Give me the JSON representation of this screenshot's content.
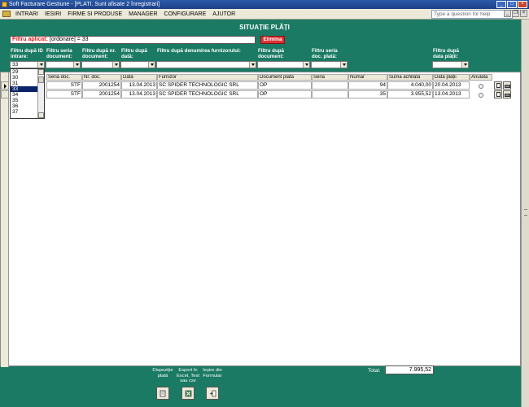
{
  "window": {
    "title": "Soft Facturare Gestiune - [PLATI. Sunt afisate 2 înregistrari]"
  },
  "menu": {
    "items": [
      "INTRARI",
      "IESIRI",
      "FIRME SI PRODUSE",
      "MANAGER",
      "CONFIGURARE",
      "AJUTOR"
    ],
    "help_placeholder": "Type a question for help"
  },
  "header": {
    "title": "SITUAȚIE PLĂȚI"
  },
  "filter_applied": {
    "label": "Filtru aplicat:",
    "value": "[ordonare] = 33",
    "remove_label": "Elimina"
  },
  "filters": {
    "id_intrare": {
      "label": "Filtru după ID intrare:",
      "value": "33"
    },
    "seria_doc": {
      "label": "Filtru seria document:",
      "value": ""
    },
    "nr_doc": {
      "label": "Filtru după nr. document:",
      "value": ""
    },
    "data": {
      "label": "Filtru după dată:",
      "value": ""
    },
    "furnizor": {
      "label": "Filtru după denumirea furnizorului:",
      "value": ""
    },
    "document": {
      "label": "Filtru după document:",
      "value": ""
    },
    "seria_plata": {
      "label": "Filtru seria doc. plată:",
      "value": ""
    },
    "data_plata": {
      "label": "Filtru după data plății:",
      "value": ""
    }
  },
  "dropdown": {
    "options": [
      "29",
      "30",
      "31",
      "33",
      "34",
      "35",
      "36",
      "37"
    ],
    "selected": "33"
  },
  "table": {
    "columns": [
      "Seria doc.",
      "Nr. doc.",
      "Data",
      "Furnizor",
      "Document plată",
      "Seria",
      "Număr",
      "Suma achitată",
      "Data plății",
      "Anulată"
    ],
    "rows": [
      {
        "seria": "STF",
        "nr": "2001254",
        "data": "13.04.2013",
        "furnizor": "SC SPIDER TECHNOLOGIC SRL",
        "doc_plata": "OP",
        "seria_plata": "",
        "numar": "94",
        "suma": "4.040,00",
        "data_platii": "20.04.2013",
        "anulata": ""
      },
      {
        "seria": "STF",
        "nr": "2001254",
        "data": "13.04.2013",
        "furnizor": "SC SPIDER TECHNOLOGIC SRL",
        "doc_plata": "OP",
        "seria_plata": "",
        "numar": "35",
        "suma": "3.955,52",
        "data_platii": "13.04.2013",
        "anulata": ""
      }
    ]
  },
  "footer": {
    "dispozitie_label": "Dispoziție plată",
    "export_label": "Export în Excel, Text sau csv",
    "iesire_label": "Ieșire din Formular",
    "total_label": "Total:",
    "total_value": "7.995,52"
  }
}
